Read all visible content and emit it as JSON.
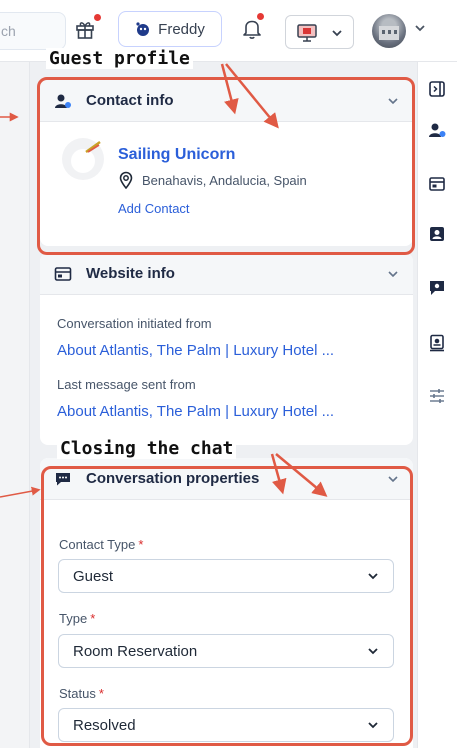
{
  "topbar": {
    "search_text": "ch",
    "freddy_label": "Freddy"
  },
  "contact_info": {
    "header": "Contact info",
    "name": "Sailing Unicorn",
    "location": "Benahavis, Andalucia, Spain",
    "add_contact": "Add Contact"
  },
  "website_info": {
    "header": "Website info",
    "initiated_label": "Conversation initiated from",
    "initiated_link": "About Atlantis, The Palm | Luxury Hotel ...",
    "last_message_label": "Last message sent from",
    "last_message_link": "About Atlantis, The Palm | Luxury Hotel ..."
  },
  "conversation_properties": {
    "header": "Conversation properties",
    "fields": [
      {
        "label": "Contact Type",
        "required_mark": "*",
        "value": "Guest"
      },
      {
        "label": "Type",
        "required_mark": "*",
        "value": "Room Reservation"
      },
      {
        "label": "Status",
        "required_mark": "*",
        "value": "Resolved"
      }
    ]
  },
  "annotations": {
    "guest_profile": "Guest profile",
    "closing_chat": "Closing the chat"
  },
  "colors": {
    "accent_blue": "#2b5fd9",
    "annotation_red": "#e05a45",
    "notification_red": "#e53935",
    "required_red": "#d92b2b"
  },
  "icons": {
    "gift": "gift-icon",
    "bell": "bell-icon",
    "screen": "screen-share-icon",
    "contact": "contact-icon",
    "website": "browser-window-icon",
    "conversation": "chat-bubble-icon",
    "location": "location-pin-icon"
  }
}
